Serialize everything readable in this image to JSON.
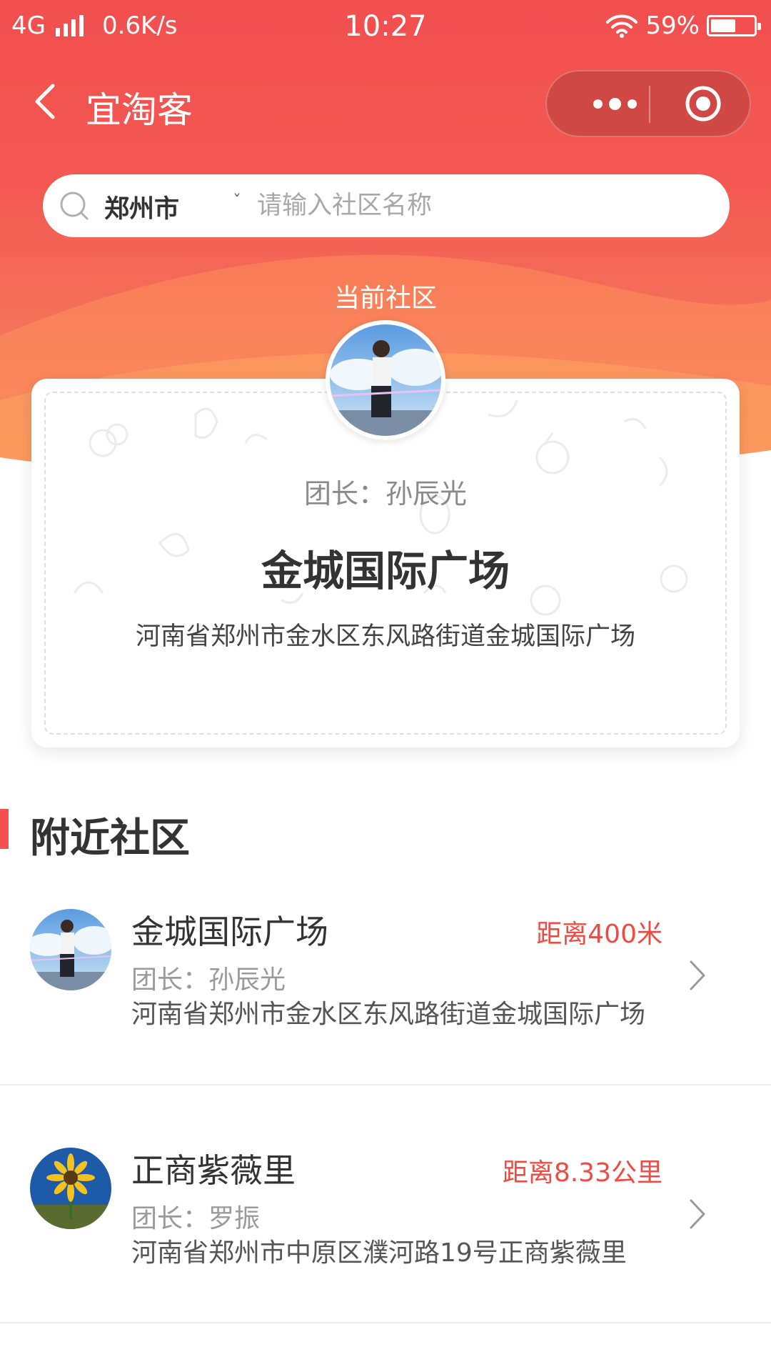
{
  "status_bar": {
    "network": "4G",
    "speed": "0.6K/s",
    "time": "10:27",
    "battery": "59%",
    "battery_level": 0.59
  },
  "nav": {
    "title": "宜淘客"
  },
  "search": {
    "city": "郑州市",
    "placeholder": "请输入社区名称"
  },
  "current": {
    "label": "当前社区",
    "leader": "团长：孙辰光",
    "name": "金城国际广场",
    "address": "河南省郑州市金水区东风路街道金城国际广场"
  },
  "nearby": {
    "title": "附近社区",
    "items": [
      {
        "name": "金城国际广场",
        "distance": "距离400米",
        "leader": "团长：孙辰光",
        "address": "河南省郑州市金水区东风路街道金城国际广场"
      },
      {
        "name": "正商紫薇里",
        "distance": "距离8.33公里",
        "leader": "团长：罗振",
        "address": "河南省郑州市中原区濮河路19号正商紫薇里"
      }
    ]
  },
  "colors": {
    "brand": "#f24f4f",
    "distance": "#ef4b43"
  }
}
